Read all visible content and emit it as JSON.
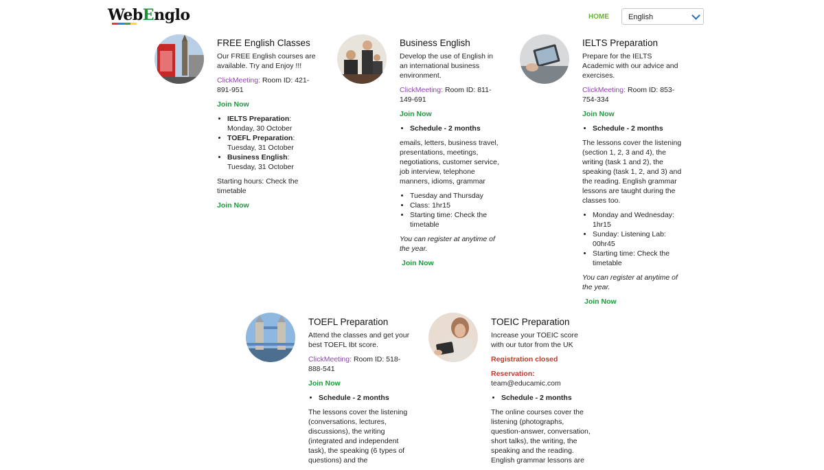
{
  "header": {
    "logo_prefix": "Web",
    "logo_e": "E",
    "logo_suffix": "nglo",
    "home": "HOME",
    "language": "English"
  },
  "cards": {
    "free": {
      "title": "FREE English Classes",
      "desc": "Our FREE English courses are available. Try and Enjoy !!!",
      "cm_label": "ClickMeeting:",
      "room": " Room ID: 421-891-951",
      "join": "Join Now",
      "items": [
        {
          "bold": "IELTS Preparation",
          "rest": ": Monday, 30 October"
        },
        {
          "bold": "TOEFL Preparation",
          "rest": ": Tuesday, 31 October"
        },
        {
          "bold": "Business English",
          "rest": ": Tuesday, 31 October"
        }
      ],
      "hours": "Starting hours: Check the timetable",
      "join2": "Join Now"
    },
    "business": {
      "title": "Business English",
      "desc": "Develop the use of English in an international business environment.",
      "cm_label": "ClickMeeting:",
      "room": " Room ID: 811-149-691",
      "join": "Join Now",
      "schedule": "Schedule - 2 months",
      "topics": "emails, letters, business travel, presentations, meetings, negotiations, customer service, job interview, telephone manners, idioms, grammar",
      "items": [
        "Tuesday and Thursday",
        "Class: 1hr15",
        "Starting time: Check the timetable"
      ],
      "note": "You can register at anytime of the year.",
      "join2": "Join Now"
    },
    "ielts": {
      "title": "IELTS Preparation",
      "desc": "Prepare for the IELTS Academic with our advice and exercises.",
      "cm_label": "ClickMeeting:",
      "room": "  Room ID: 853-754-334",
      "join": "Join Now",
      "schedule": "Schedule - 2 months",
      "body": "The lessons cover the listening (section 1, 2, 3 and 4), the writing (task 1 and 2), the speaking (task 1, 2, and 3) and the reading. English grammar lessons are taught during the classes too.",
      "items": [
        "Monday and Wednesday: 1hr15",
        "Sunday: Listening Lab: 00hr45",
        "Starting time: Check the timetable"
      ],
      "note": "You can register at anytime of the year.",
      "join2": "Join Now"
    },
    "toefl": {
      "title": "TOEFL Preparation",
      "desc": "Attend the classes and get your best TOEFL Ibt score.",
      "cm_label": "ClickMeeting:",
      "room": " Room ID: 518-888-541",
      "join": "Join Now",
      "schedule": "Schedule - 2 months",
      "body": "The lessons cover the listening (conversations, lectures, discussions), the writing (integrated and independent task), the speaking (6 types of questions) and the"
    },
    "toeic": {
      "title": "TOEIC Preparation",
      "desc": "Increase your TOEIC score with our tutor from the UK",
      "closed": "Registration closed",
      "reservation_label": "Reservation:",
      "reservation_email": "team@educamic.com",
      "schedule": "Schedule - 2 months",
      "body": "The online courses cover the listening (photographs, question-answer, conversation, short talks), the writing, the speaking and the reading. English grammar lessons are"
    }
  }
}
